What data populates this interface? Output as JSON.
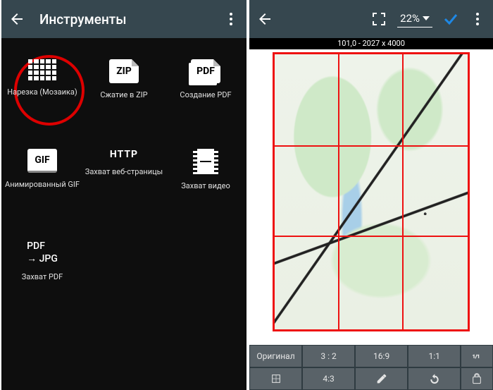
{
  "left": {
    "title": "Инструменты",
    "tools": [
      {
        "label": "Нарезка (Мозаика)"
      },
      {
        "label": "Сжатие в ZIP",
        "badge": "ZIP"
      },
      {
        "label": "Создание PDF",
        "badge": "PDF"
      },
      {
        "label": "Анимированный GIF",
        "badge": "GIF"
      },
      {
        "label": "Захват веб-страницы",
        "badge": "HTTP"
      },
      {
        "label": "Захват видео"
      },
      {
        "label": "Захват PDF",
        "pdfjpg_line1": "PDF",
        "pdfjpg_line2": "→ JPG"
      }
    ]
  },
  "right": {
    "zoom": "22%",
    "dimensions": "101,0 - 2027 x 4000",
    "ratio_row1": [
      "Оригинал",
      "3 : 2",
      "16:9",
      "1:1"
    ],
    "ratio_row2": [
      "",
      "4:3",
      "",
      ""
    ]
  }
}
